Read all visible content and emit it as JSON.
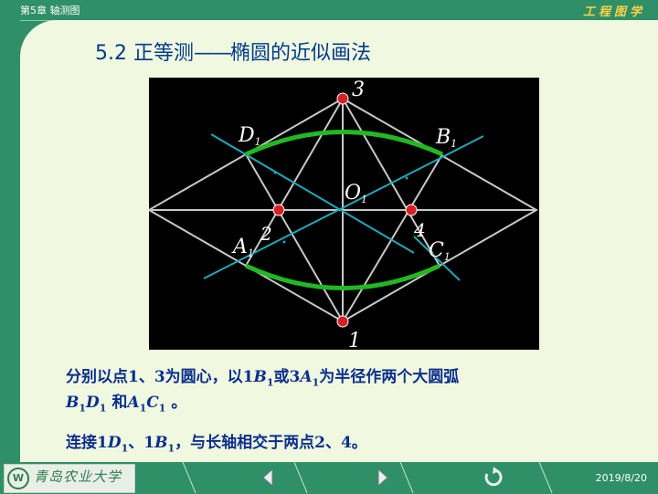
{
  "header": {
    "chapter": "第5章  轴测图",
    "course": "工程图学"
  },
  "title": {
    "prefix": "5.2  正等测",
    "dash": "——",
    "rest": "椭圆的近似画法"
  },
  "figure": {
    "labels": {
      "top": "3",
      "bottom": "1",
      "left_point": "2",
      "right_point": "4",
      "center": "O",
      "center_sub": "1",
      "d": "D",
      "d_sub": "1",
      "b": "B",
      "b_sub": "1",
      "a": "A",
      "a_sub": "1",
      "c": "C",
      "c_sub": "1"
    },
    "colors": {
      "frame": "#c8c8c8",
      "arc": "#22b822",
      "axis": "#1fa8b8",
      "point": "#d81f26"
    }
  },
  "text": {
    "line1_a": "分别以点1、3为圆心，以1",
    "line1_b": "B",
    "line1_b_sub": "1",
    "line1_c": "或3",
    "line1_d": "A",
    "line1_d_sub": "1",
    "line1_e": "为半径作两个大圆弧",
    "line2_a": "B",
    "line2_a_sub": "1",
    "line2_b": "D",
    "line2_b_sub": "1",
    "line2_c": " 和",
    "line2_d": "A",
    "line2_d_sub": "1",
    "line2_e": "C",
    "line2_e_sub": "1",
    "line2_f": " 。",
    "line3_a": "连接1",
    "line3_b": "D",
    "line3_b_sub": "1",
    "line3_c": "、1",
    "line3_d": "B",
    "line3_d_sub": "1",
    "line3_e": "，与长轴相交于两点2、4。"
  },
  "footer": {
    "logo_mark": "W",
    "logo_text": "青岛农业大学",
    "date": "2019/8/20"
  },
  "nav": {
    "prev_icon": "triangle-left-icon",
    "next_icon": "triangle-right-icon",
    "return_icon": "return-circle-icon"
  }
}
